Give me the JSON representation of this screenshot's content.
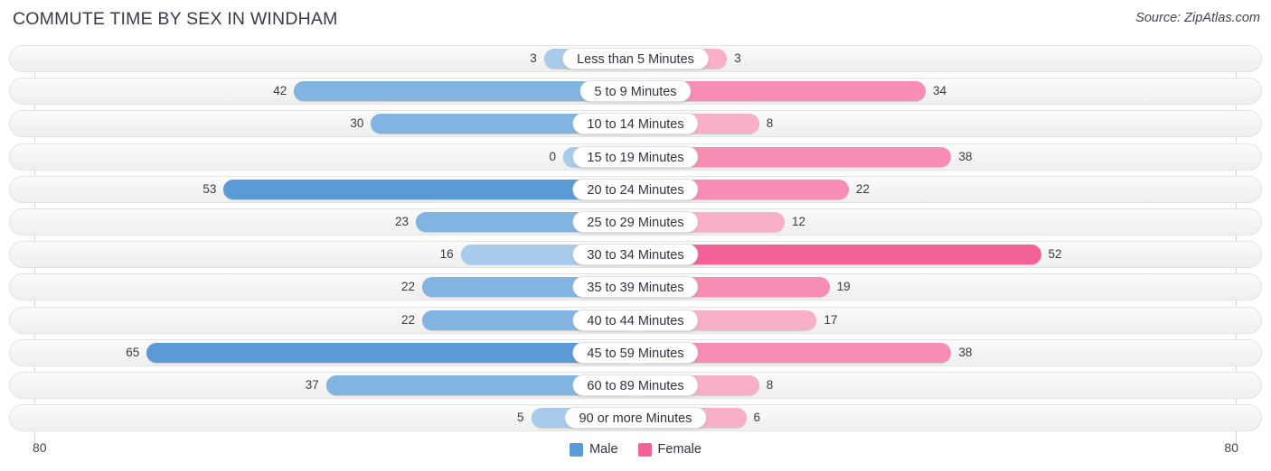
{
  "header": {
    "title": "COMMUTE TIME BY SEX IN WINDHAM",
    "source": "Source: ZipAtlas.com"
  },
  "axis": {
    "left_label": "80",
    "right_label": "80",
    "max": 80
  },
  "legend": {
    "items": [
      {
        "label": "Male",
        "color": "#5b9bd5"
      },
      {
        "label": "Female",
        "color": "#f4629a"
      }
    ]
  },
  "colors": {
    "male_light": "#a8cbeb",
    "male_mid": "#82b4e2",
    "male_dark": "#5b9bd5",
    "female_light": "#f8afc8",
    "female_mid": "#f78cb4",
    "female_dark": "#f4629a"
  },
  "chart_data": {
    "type": "bar",
    "title": "COMMUTE TIME BY SEX IN WINDHAM",
    "orientation": "horizontal-diverging",
    "xlabel": "",
    "ylabel": "",
    "xlim": [
      80,
      80
    ],
    "grid": false,
    "legend_position": "bottom-center",
    "categories": [
      "Less than 5 Minutes",
      "5 to 9 Minutes",
      "10 to 14 Minutes",
      "15 to 19 Minutes",
      "20 to 24 Minutes",
      "25 to 29 Minutes",
      "30 to 34 Minutes",
      "35 to 39 Minutes",
      "40 to 44 Minutes",
      "45 to 59 Minutes",
      "60 to 89 Minutes",
      "90 or more Minutes"
    ],
    "series": [
      {
        "name": "Male",
        "color": "#5b9bd5",
        "values": [
          3,
          42,
          30,
          0,
          53,
          23,
          16,
          22,
          22,
          65,
          37,
          5
        ]
      },
      {
        "name": "Female",
        "color": "#f4629a",
        "values": [
          3,
          34,
          8,
          38,
          22,
          12,
          52,
          19,
          17,
          38,
          8,
          6
        ]
      }
    ]
  },
  "rows": [
    {
      "label": "Less than 5 Minutes",
      "male": 3,
      "female": 3,
      "male_text": "3",
      "female_text": "3"
    },
    {
      "label": "5 to 9 Minutes",
      "male": 42,
      "female": 34,
      "male_text": "42",
      "female_text": "34"
    },
    {
      "label": "10 to 14 Minutes",
      "male": 30,
      "female": 8,
      "male_text": "30",
      "female_text": "8"
    },
    {
      "label": "15 to 19 Minutes",
      "male": 0,
      "female": 38,
      "male_text": "0",
      "female_text": "38"
    },
    {
      "label": "20 to 24 Minutes",
      "male": 53,
      "female": 22,
      "male_text": "53",
      "female_text": "22"
    },
    {
      "label": "25 to 29 Minutes",
      "male": 23,
      "female": 12,
      "male_text": "23",
      "female_text": "12"
    },
    {
      "label": "30 to 34 Minutes",
      "male": 16,
      "female": 52,
      "male_text": "16",
      "female_text": "52"
    },
    {
      "label": "35 to 39 Minutes",
      "male": 22,
      "female": 19,
      "male_text": "22",
      "female_text": "19"
    },
    {
      "label": "40 to 44 Minutes",
      "male": 22,
      "female": 17,
      "male_text": "22",
      "female_text": "17"
    },
    {
      "label": "45 to 59 Minutes",
      "male": 65,
      "female": 38,
      "male_text": "65",
      "female_text": "38"
    },
    {
      "label": "60 to 89 Minutes",
      "male": 37,
      "female": 8,
      "male_text": "37",
      "female_text": "8"
    },
    {
      "label": "90 or more Minutes",
      "male": 5,
      "female": 6,
      "male_text": "5",
      "female_text": "6"
    }
  ]
}
